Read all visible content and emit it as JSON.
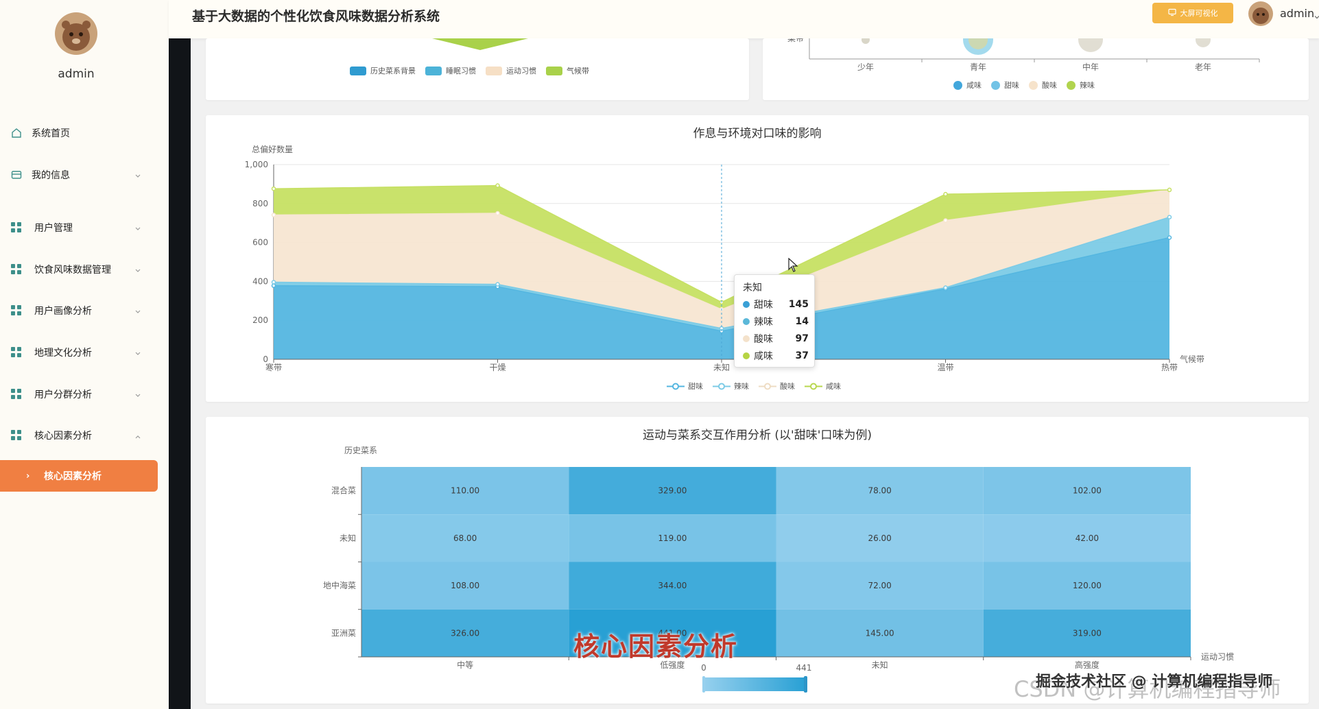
{
  "app": {
    "title": "基于大数据的个性化饮食风味数据分析系统",
    "bigscreen_button": "大屏可视化",
    "header_user": "admin"
  },
  "sidebar": {
    "user_name": "admin",
    "items": [
      {
        "label": "系统首页",
        "icon": "home-icon"
      },
      {
        "label": "我的信息",
        "icon": "card-icon"
      },
      {
        "label": "用户管理",
        "icon": "grid-icon"
      },
      {
        "label": "饮食风味数据管理",
        "icon": "grid-icon"
      },
      {
        "label": "用户画像分析",
        "icon": "grid-icon"
      },
      {
        "label": "地理文化分析",
        "icon": "grid-icon"
      },
      {
        "label": "用户分群分析",
        "icon": "grid-icon"
      },
      {
        "label": "核心因素分析",
        "icon": "grid-icon"
      }
    ],
    "active_sub": "核心因素分析"
  },
  "top_left_legend": [
    "历史菜系背景",
    "睡眠习惯",
    "运动习惯",
    "气候带"
  ],
  "top_left_colors": [
    "#2f9bd0",
    "#4cb3d8",
    "#f6dfc5",
    "#a9d14a"
  ],
  "top_right": {
    "y_label": "菜带",
    "x_categories": [
      "少年",
      "青年",
      "中年",
      "老年"
    ],
    "legend": [
      "咸味",
      "甜味",
      "酸味",
      "辣味"
    ],
    "colors": [
      "#42a7dc",
      "#72c3e6",
      "#f6e3cb",
      "#b1d44e"
    ]
  },
  "chart_data": [
    {
      "type": "area",
      "title": "作息与环境对口味的影响",
      "ylabel": "总偏好数量",
      "xlabel": "气候带",
      "categories": [
        "寒带",
        "干燥",
        "未知",
        "温带",
        "热带"
      ],
      "ylim": [
        0,
        1000
      ],
      "yticks": [
        "0",
        "200",
        "400",
        "600",
        "800",
        "1,000"
      ],
      "stacked": true,
      "series": [
        {
          "name": "甜味",
          "values": [
            378,
            373,
            145,
            362,
            625
          ],
          "color": "#54b6e0"
        },
        {
          "name": "辣味",
          "values": [
            18,
            12,
            14,
            6,
            105
          ],
          "color": "#7ccbe6"
        },
        {
          "name": "酸味",
          "values": [
            345,
            365,
            97,
            345,
            140
          ],
          "color": "#f7e6d2"
        },
        {
          "name": "咸味",
          "values": [
            135,
            142,
            37,
            135,
            0
          ],
          "color": "#c6e063"
        }
      ],
      "tooltip": {
        "category": "未知",
        "rows": [
          [
            "甜味",
            "145"
          ],
          [
            "辣味",
            "14"
          ],
          [
            "酸味",
            "97"
          ],
          [
            "咸味",
            "37"
          ]
        ]
      }
    },
    {
      "type": "heatmap",
      "title": "运动与菜系交互作用分析 (以'甜味'口味为例)",
      "ylabel": "历史菜系",
      "xlabel": "运动习惯",
      "x_categories": [
        "中等",
        "低强度",
        "未知",
        "高强度"
      ],
      "y_categories": [
        "混合菜",
        "未知",
        "地中海菜",
        "亚洲菜"
      ],
      "values": [
        [
          110.0,
          329.0,
          78.0,
          102.0
        ],
        [
          68.0,
          119.0,
          26.0,
          42.0
        ],
        [
          108.0,
          344.0,
          72.0,
          120.0
        ],
        [
          326.0,
          441.0,
          145.0,
          319.0
        ]
      ],
      "labels": [
        [
          "110.00",
          "329.00",
          "78.00",
          "102.00"
        ],
        [
          "68.00",
          "119.00",
          "26.00",
          "42.00"
        ],
        [
          "108.00",
          "344.00",
          "72.00",
          "120.00"
        ],
        [
          "326.00",
          "441.00",
          "145.00",
          "319.00"
        ]
      ],
      "visual_map": {
        "min": "0",
        "max": "441"
      }
    }
  ],
  "overlay": {
    "caption": "核心因素分析",
    "watermark": "CSDN @计算机编程指导师",
    "watermark_top": "掘金技术社区 @ 计算机编程指导师"
  }
}
